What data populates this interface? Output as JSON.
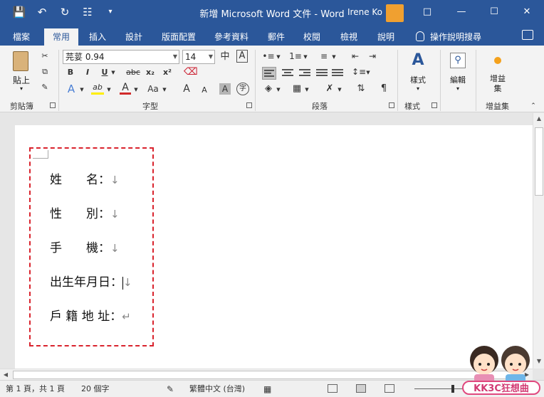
{
  "titlebar": {
    "title": "新增 Microsoft Word 文件 - Word",
    "user_name": "Irene Ko",
    "qat": [
      "save-icon",
      "undo-icon",
      "redo-icon",
      "print-preview-icon",
      "customize-qat-icon"
    ],
    "window_buttons": [
      "ribbon-display-options-icon",
      "minimize-icon",
      "maximize-icon",
      "close-icon"
    ]
  },
  "tabs": [
    {
      "label": "檔案"
    },
    {
      "label": "常用",
      "active": true
    },
    {
      "label": "插入"
    },
    {
      "label": "設計"
    },
    {
      "label": "版面配置"
    },
    {
      "label": "參考資料"
    },
    {
      "label": "郵件"
    },
    {
      "label": "校閱"
    },
    {
      "label": "檢視"
    },
    {
      "label": "說明"
    }
  ],
  "tell_me": "操作說明搜尋",
  "ribbon": {
    "clipboard": {
      "label": "剪貼簿",
      "paste_label": "貼上"
    },
    "font": {
      "label": "字型",
      "font_name": "芫荽 0.94",
      "font_size": "14",
      "bold": "B",
      "italic": "I",
      "underline": "U",
      "strike": "abc",
      "subscript": "x₂",
      "superscript": "x²",
      "change_case": "Aa",
      "grow": "A",
      "shrink": "A",
      "phonetic": "中",
      "char_border": "A",
      "char_shading": "A",
      "enclose": "字",
      "text_effects": "A",
      "highlight": "ab",
      "font_color": "A"
    },
    "paragraph": {
      "label": "段落"
    },
    "styles": {
      "label": "樣式",
      "button_label": "樣式"
    },
    "editing": {
      "button_label": "編輯"
    },
    "addins": {
      "label": "增益集",
      "button_label": "增益集"
    }
  },
  "document": {
    "lines": [
      {
        "text": "姓　　名：",
        "mark": "↓"
      },
      {
        "text": "性　　別：",
        "mark": "↓"
      },
      {
        "text": "手　　機：",
        "mark": "↓"
      },
      {
        "text": "出生年月日：",
        "mark": "↓"
      },
      {
        "text": "戶 籍 地 址：",
        "mark": "↵"
      }
    ]
  },
  "statusbar": {
    "page_info": "第 1 頁，共 1 頁",
    "word_count": "20 個字",
    "language": "繁體中文 (台灣)"
  },
  "logo_text": "KK3C狂想曲",
  "colors": {
    "brand": "#2b579a",
    "frame_dash": "#d9232d"
  }
}
